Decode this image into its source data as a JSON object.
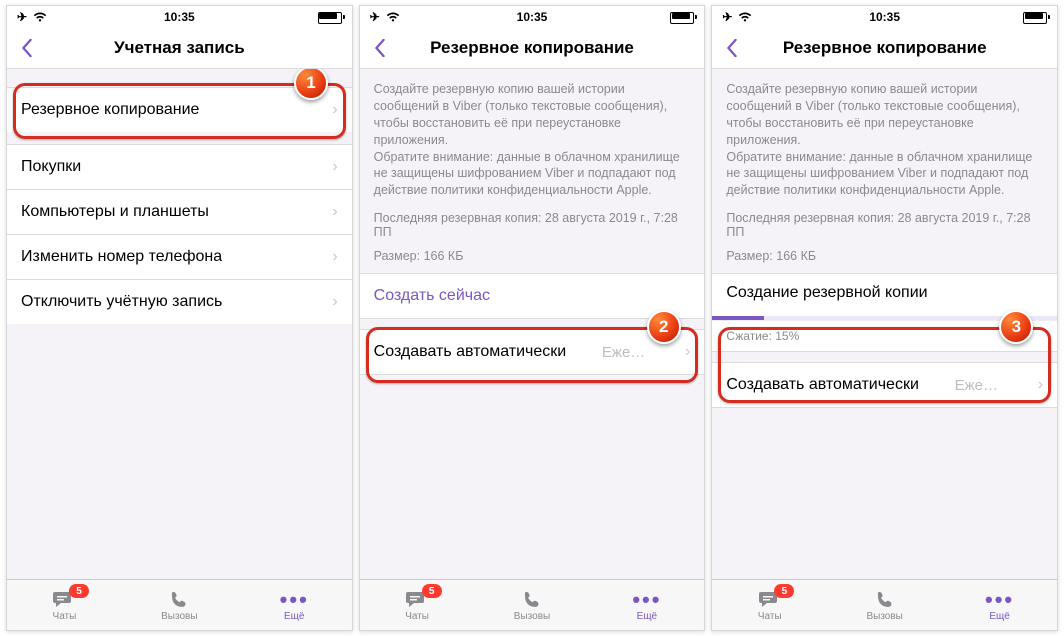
{
  "status": {
    "time": "10:35"
  },
  "p1": {
    "title": "Учетная запись",
    "items": [
      {
        "label": "Резервное копирование"
      },
      {
        "label": "Покупки"
      },
      {
        "label": "Компьютеры и планшеты"
      },
      {
        "label": "Изменить номер телефона"
      },
      {
        "label": "Отключить учётную запись"
      }
    ]
  },
  "p2": {
    "title": "Резервное копирование",
    "desc": "Создайте резервную копию вашей истории сообщений в Viber (только текстовые сообщения), чтобы восстановить её при переустановке приложения.\nОбратите внимание: данные в облачном хранилище не защищены шифрованием Viber и подпадают под действие политики конфиденциальности Apple.",
    "meta1": "Последняя резервная копия: 28 августа 2019 г., 7:28 ПП",
    "meta2": "Размер: 166 КБ",
    "create_now": "Создать сейчас",
    "auto_label": "Создавать автоматически",
    "auto_value": "Еже…"
  },
  "p3": {
    "title": "Резервное копирование",
    "desc": "Создайте резервную копию вашей истории сообщений в Viber (только текстовые сообщения), чтобы восстановить её при переустановке приложения.\nОбратите внимание: данные в облачном хранилище не защищены шифрованием Viber и подпадают под действие политики конфиденциальности Apple.",
    "meta1": "Последняя резервная копия: 28 августа 2019 г., 7:28 ПП",
    "meta2": "Размер: 166 КБ",
    "creating": "Создание резервной копии",
    "compress": "Сжатие: 15%",
    "progress_percent": 15,
    "auto_label": "Создавать автоматически",
    "auto_value": "Еже…"
  },
  "tabs": {
    "chats": "Чаты",
    "calls": "Вызовы",
    "more": "Ещё",
    "badge": "5"
  },
  "markers": {
    "n1": "1",
    "n2": "2",
    "n3": "3"
  }
}
